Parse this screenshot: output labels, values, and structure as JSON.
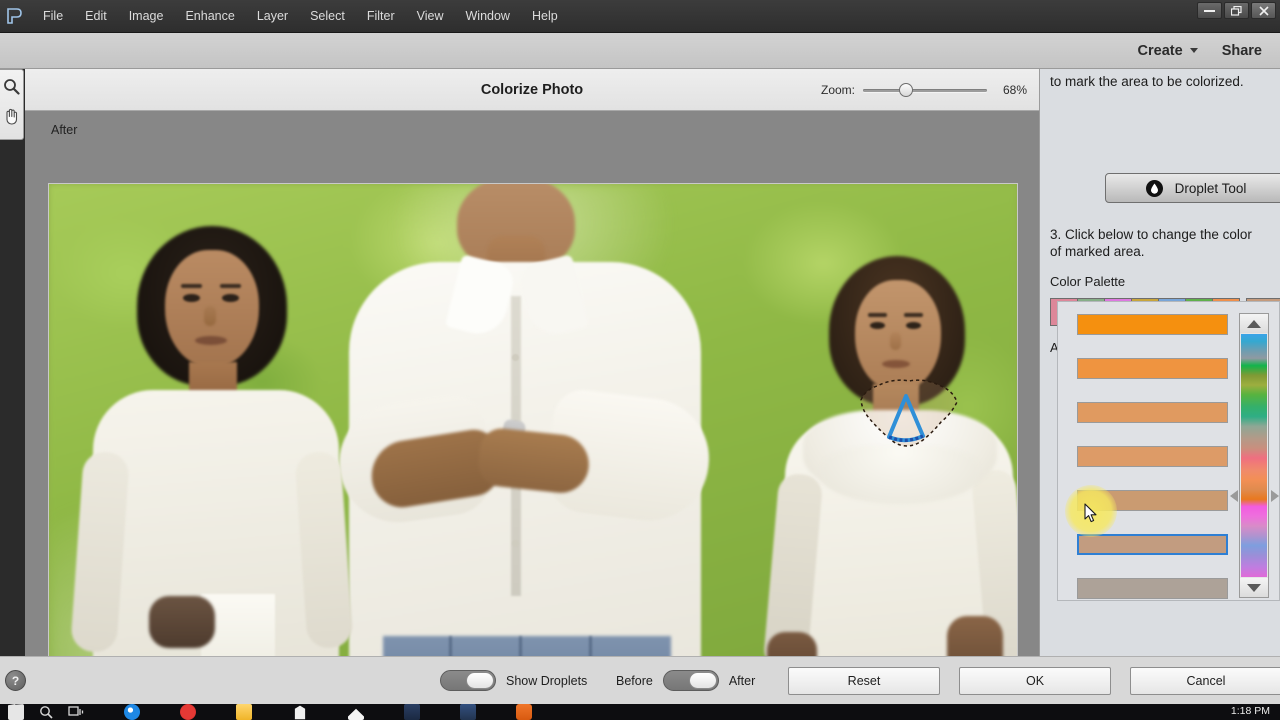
{
  "window": {
    "app_logo": "photoshop-elements-logo",
    "controls": {
      "minimize": "—",
      "restore": "❐",
      "close": "×"
    }
  },
  "menubar": {
    "items": [
      "File",
      "Edit",
      "Image",
      "Enhance",
      "Layer",
      "Select",
      "Filter",
      "View",
      "Window",
      "Help"
    ]
  },
  "topbar": {
    "create_label": "Create",
    "share_label": "Share"
  },
  "tools": {
    "zoom_tool": "magnifier-icon",
    "hand_tool": "hand-icon"
  },
  "stage": {
    "title": "Colorize Photo",
    "zoom_label": "Zoom:",
    "zoom_value": "68%",
    "zoom_percent": 68,
    "view_label": "After"
  },
  "photo": {
    "description": "colorized vintage family photograph: two girls in white dresses and a man in a white shirt with crossed arms, green foliage background",
    "selection": "dotted-marquee-around-neck",
    "droplet_stroke_color": "#2f8fd8"
  },
  "sidepanel": {
    "step2_text": "to mark the area to be colorized.",
    "droplet_button": "Droplet Tool",
    "droplet_icon": "droplet-icon",
    "step3_text": "3. Click below to change the color of marked area.",
    "palette_heading": "Color Palette",
    "palette_swatches": [
      "#dd8799",
      "#87ae88",
      "#dd78e0",
      "#c8a53c",
      "#78a5d8",
      "#5fb04b",
      "#ef8f4b"
    ],
    "palette_wide_swatch": "#c49a7c",
    "applicable_heading": "All Applicable Colors",
    "eyedropper_icon": "eyedropper-icon",
    "color_bars": [
      {
        "color": "#f5900f",
        "selected": false
      },
      {
        "color": "#ef9440",
        "selected": false
      },
      {
        "color": "#e09a60",
        "selected": false
      },
      {
        "color": "#dd9b67",
        "selected": false
      },
      {
        "color": "#ca9b71",
        "selected": false
      },
      {
        "color": "#c29c80",
        "selected": true
      },
      {
        "color": "#ada298",
        "selected": false
      }
    ],
    "scroll_up_icon": "scroll-up-arrow-icon",
    "scroll_down_icon": "scroll-down-arrow-icon",
    "ramp_marker_left": "position-marker-left-icon",
    "ramp_marker_right": "position-marker-right-icon"
  },
  "bottombar": {
    "help_label": "?",
    "show_droplets_label": "Show Droplets",
    "show_droplets_on": true,
    "before_label": "Before",
    "after_label": "After",
    "before_after_on": true,
    "reset_label": "Reset",
    "ok_label": "OK",
    "cancel_label": "Cancel"
  },
  "taskbar": {
    "clock": "1:18 PM",
    "icons": [
      "start-icon",
      "search-icon",
      "task-view-icon",
      "browser-icon",
      "record-icon",
      "folder-icon",
      "store-icon",
      "mail-icon",
      "app-icon",
      "app-icon-2",
      "editor-icon"
    ]
  }
}
